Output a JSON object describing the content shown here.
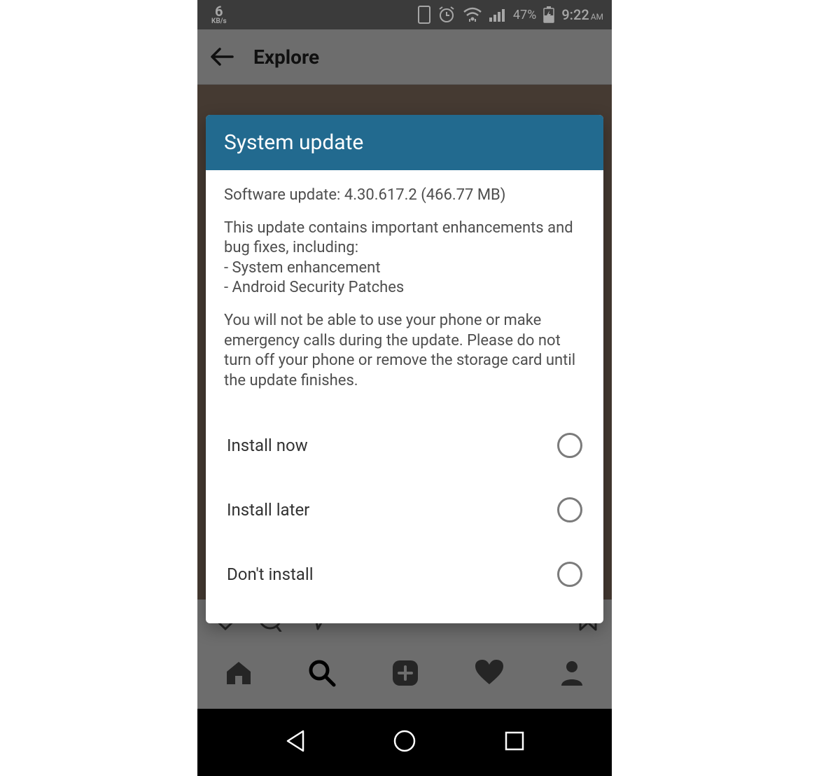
{
  "status": {
    "speed_num": "6",
    "speed_unit": "KB/s",
    "battery_pct": "47%",
    "time": "9:22",
    "ampm": "AM"
  },
  "app_header": {
    "title": "Explore"
  },
  "modal": {
    "title": "System update",
    "version_line": "Software update: 4.30.617.2 (466.77 MB)",
    "desc_intro": "This update contains important enhancements and bug fixes, including:",
    "desc_item1": "- System enhancement",
    "desc_item2": "- Android Security Patches",
    "warning": "You will not be able to use your phone or make emergency calls during the update. Please do not turn off your phone or remove the storage card until the update finishes.",
    "options": [
      {
        "label": "Install now"
      },
      {
        "label": "Install later"
      },
      {
        "label": "Don't install"
      }
    ]
  }
}
